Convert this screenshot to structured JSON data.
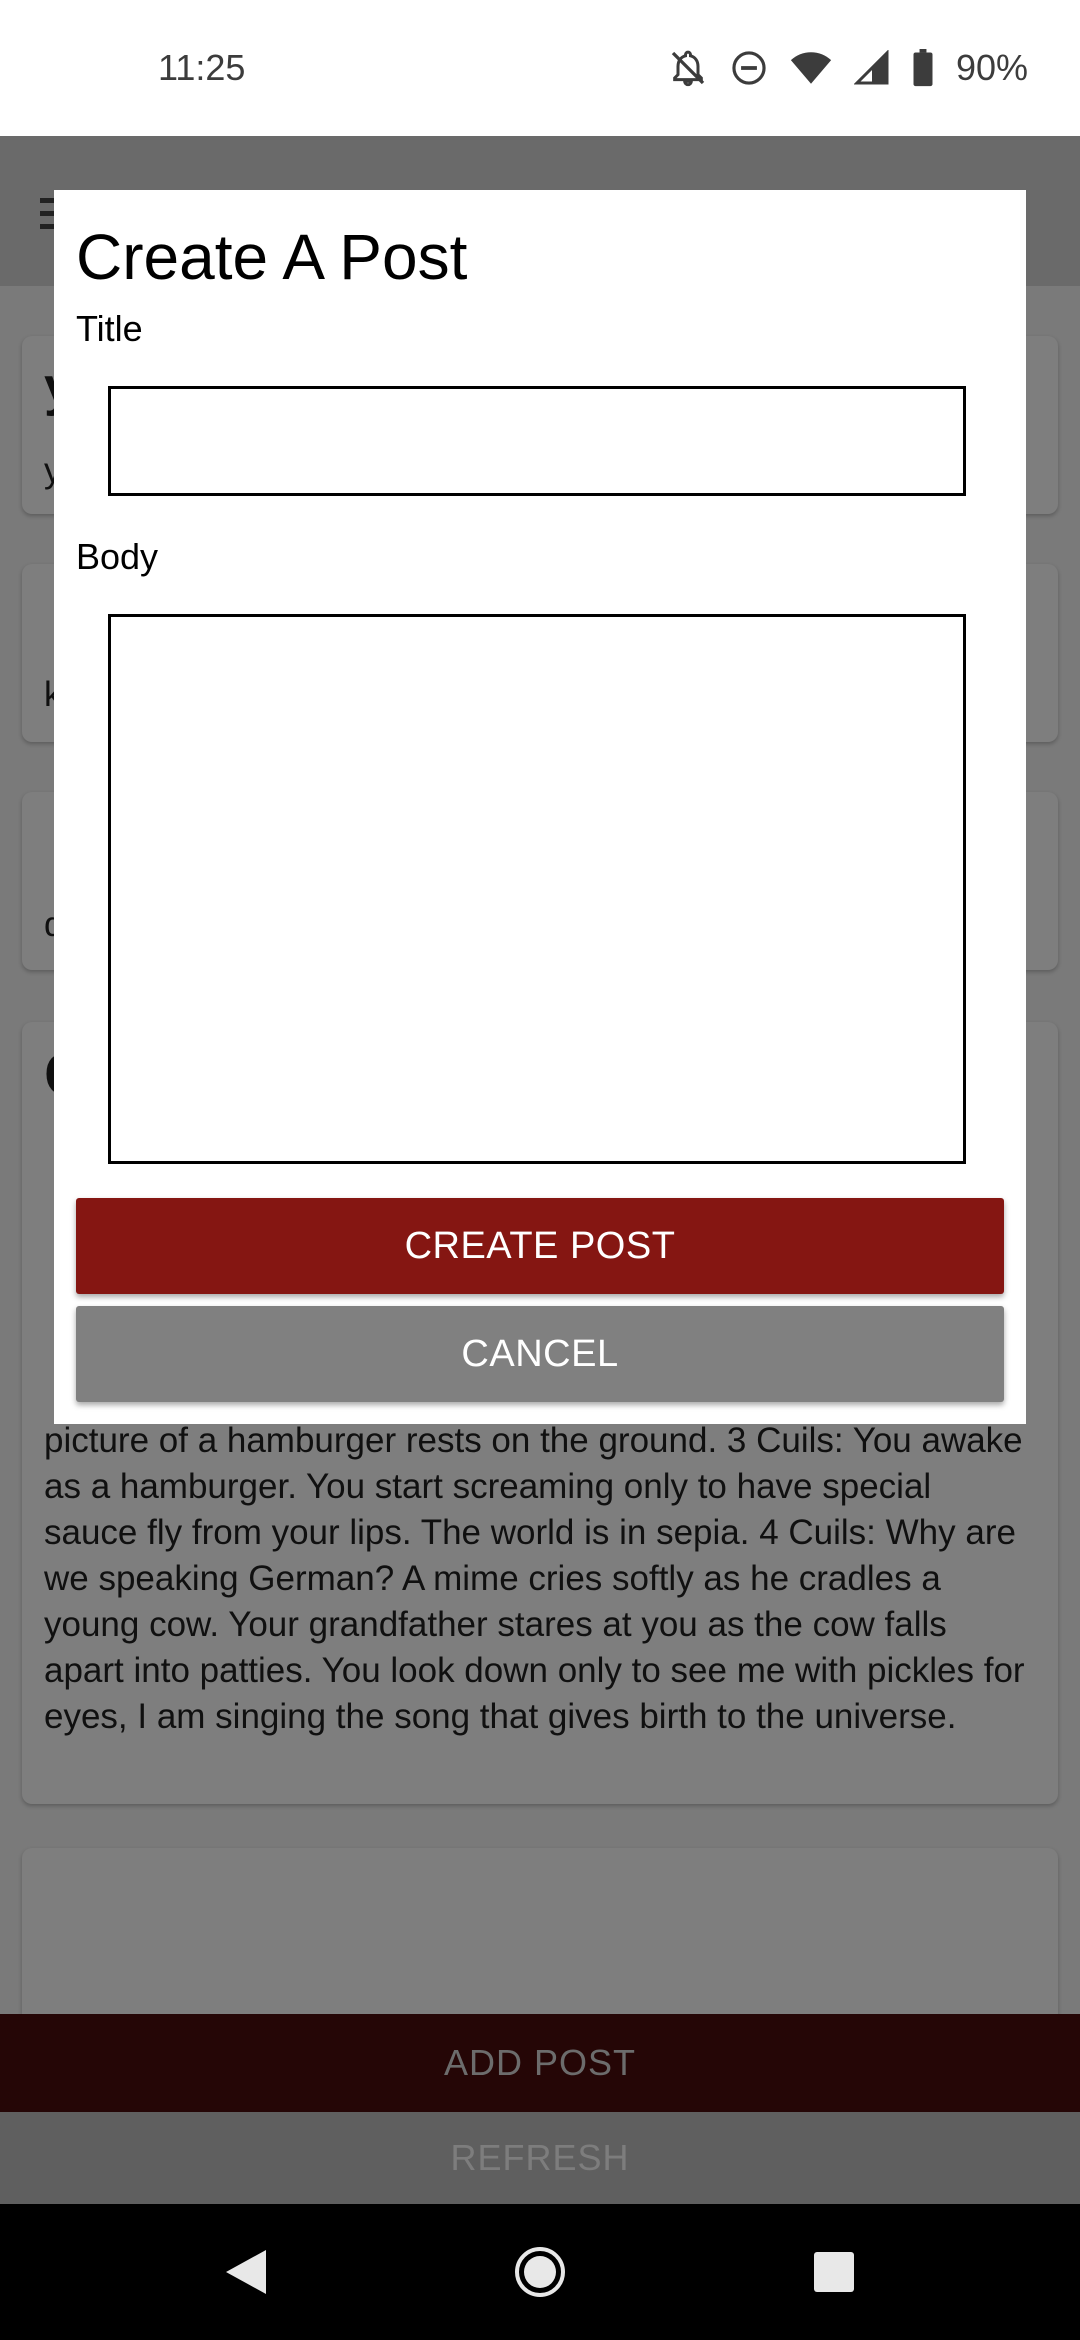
{
  "status_bar": {
    "time": "11:25",
    "battery_percent": "90%",
    "icons": [
      "notifications-off-icon",
      "do-not-disturb-icon",
      "wifi-icon",
      "cell-signal-icon",
      "battery-icon"
    ]
  },
  "app": {
    "add_post_label": "ADD POST",
    "refresh_label": "REFRESH",
    "cards": [
      {
        "title": "y",
        "body": "y"
      },
      {
        "title": "",
        "body": "k"
      },
      {
        "title": "",
        "body": "d"
      },
      {
        "title": "C",
        "body": "picture of a hamburger rests on the ground.  3 Cuils: You awake as a hamburger. You start screaming only to have special sauce fly from your lips. The world is in sepia.  4 Cuils: Why are we speaking German? A mime cries softly as he cradles a young cow. Your grandfather stares at you as the cow falls apart into patties. You look down only to see me with pickles for eyes, I am singing the song that gives birth to the universe."
      },
      {
        "title": "",
        "body": ""
      }
    ]
  },
  "dialog": {
    "title": "Create A Post",
    "title_field_label": "Title",
    "title_field_value": "",
    "body_field_label": "Body",
    "body_field_value": "",
    "create_label": "CREATE POST",
    "cancel_label": "CANCEL"
  },
  "colors": {
    "accent": "#851612",
    "cancel": "#808080",
    "scrim_button": "#250606"
  }
}
